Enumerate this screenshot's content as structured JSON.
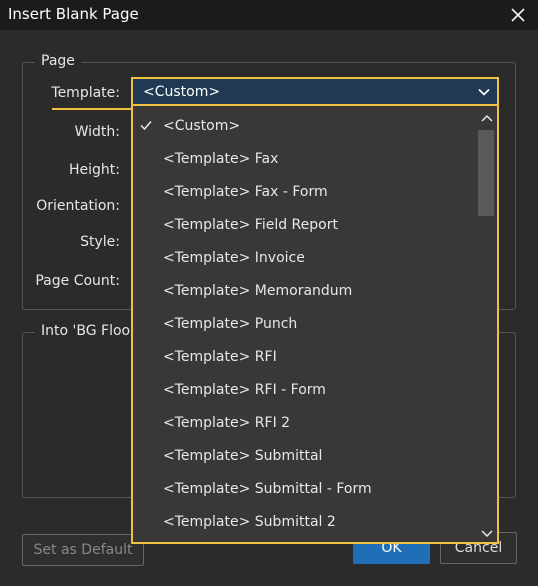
{
  "window": {
    "title": "Insert Blank Page",
    "close_icon": "close-icon"
  },
  "page_group": {
    "legend": "Page",
    "labels": {
      "template": "Template:",
      "width": "Width:",
      "height": "Height:",
      "orientation": "Orientation:",
      "style": "Style:",
      "page_count": "Page Count:"
    }
  },
  "into_group": {
    "legend": "Into 'BG Floor"
  },
  "template_combo": {
    "value": "<Custom>",
    "expanded": true,
    "options": [
      {
        "label": "<Custom>",
        "selected": true
      },
      {
        "label": "<Template> Fax",
        "selected": false
      },
      {
        "label": "<Template> Fax - Form",
        "selected": false
      },
      {
        "label": "<Template> Field Report",
        "selected": false
      },
      {
        "label": "<Template> Invoice",
        "selected": false
      },
      {
        "label": "<Template> Memorandum",
        "selected": false
      },
      {
        "label": "<Template> Punch",
        "selected": false
      },
      {
        "label": "<Template> RFI",
        "selected": false
      },
      {
        "label": "<Template> RFI - Form",
        "selected": false
      },
      {
        "label": "<Template> RFI 2",
        "selected": false
      },
      {
        "label": "<Template> Submittal",
        "selected": false
      },
      {
        "label": "<Template> Submittal - Form",
        "selected": false
      },
      {
        "label": "<Template> Submittal 2",
        "selected": false
      }
    ]
  },
  "buttons": {
    "set_default": "Set as Default",
    "ok": "OK",
    "cancel": "Cancel"
  },
  "colors": {
    "focus_outline": "#f0c040",
    "combo_bg": "#1f3a52",
    "dropdown_bg": "#383838",
    "dialog_bg": "#2b2b2b",
    "ok_button": "#1e6fb8"
  }
}
